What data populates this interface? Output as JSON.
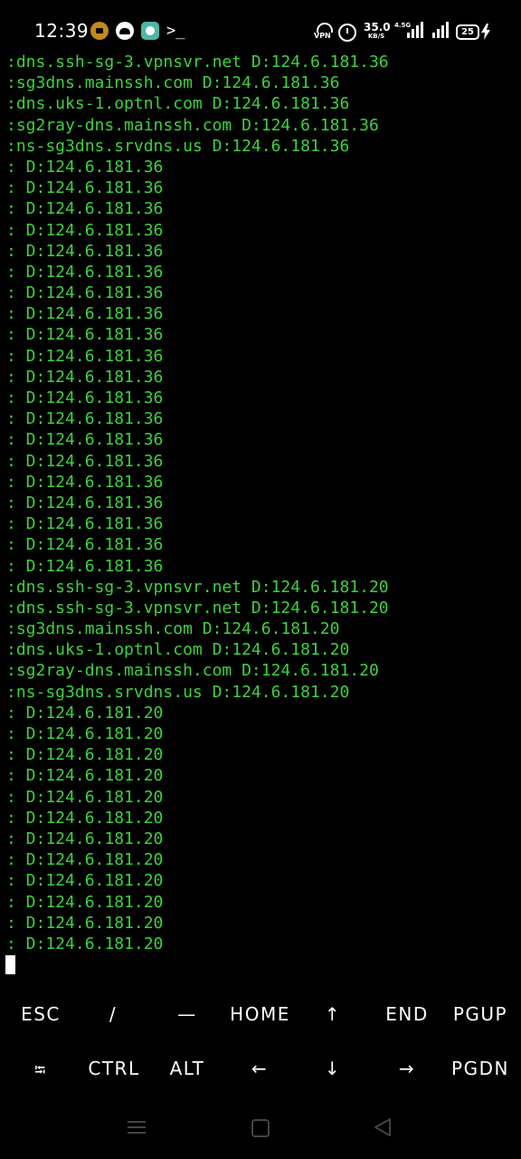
{
  "status_bar": {
    "time": "12:39",
    "vpn_label": "VPN",
    "speed_value": "35.0",
    "speed_unit": "KB/S",
    "network_label": "4.5G",
    "battery_level": "25",
    "icons": [
      "app-notification-icon",
      "cloud-notification-icon",
      "chat-notification-icon",
      "terminal-notification-icon",
      "vpn-icon",
      "alarm-icon",
      "signal-icon",
      "charging-icon"
    ]
  },
  "terminal": {
    "text_color": "#3cd33c",
    "lines": [
      ":dns.ssh-sg-3.vpnsvr.net D:124.6.181.36",
      ":sg3dns.mainssh.com D:124.6.181.36",
      ":dns.uks-1.optnl.com D:124.6.181.36",
      ":sg2ray-dns.mainssh.com D:124.6.181.36",
      ":ns-sg3dns.srvdns.us D:124.6.181.36",
      ": D:124.6.181.36",
      ": D:124.6.181.36",
      ": D:124.6.181.36",
      ": D:124.6.181.36",
      ": D:124.6.181.36",
      ": D:124.6.181.36",
      ": D:124.6.181.36",
      ": D:124.6.181.36",
      ": D:124.6.181.36",
      ": D:124.6.181.36",
      ": D:124.6.181.36",
      ": D:124.6.181.36",
      ": D:124.6.181.36",
      ": D:124.6.181.36",
      ": D:124.6.181.36",
      ": D:124.6.181.36",
      ": D:124.6.181.36",
      ": D:124.6.181.36",
      ": D:124.6.181.36",
      ": D:124.6.181.36",
      ":dns.ssh-sg-3.vpnsvr.net D:124.6.181.20",
      ":dns.ssh-sg-3.vpnsvr.net D:124.6.181.20",
      ":sg3dns.mainssh.com D:124.6.181.20",
      ":dns.uks-1.optnl.com D:124.6.181.20",
      ":sg2ray-dns.mainssh.com D:124.6.181.20",
      ":ns-sg3dns.srvdns.us D:124.6.181.20",
      ": D:124.6.181.20",
      ": D:124.6.181.20",
      ": D:124.6.181.20",
      ": D:124.6.181.20",
      ": D:124.6.181.20",
      ": D:124.6.181.20",
      ": D:124.6.181.20",
      ": D:124.6.181.20",
      ": D:124.6.181.20",
      ": D:124.6.181.20",
      ": D:124.6.181.20",
      ": D:124.6.181.20"
    ]
  },
  "extra_keys": {
    "row1": [
      "ESC",
      "/",
      "—",
      "HOME",
      "↑",
      "END",
      "PGUP"
    ],
    "row2": [
      "⭾",
      "CTRL",
      "ALT",
      "←",
      "↓",
      "→",
      "PGDN"
    ]
  },
  "nav_bar": {
    "buttons": [
      "menu-icon",
      "home-icon",
      "back-icon"
    ]
  }
}
